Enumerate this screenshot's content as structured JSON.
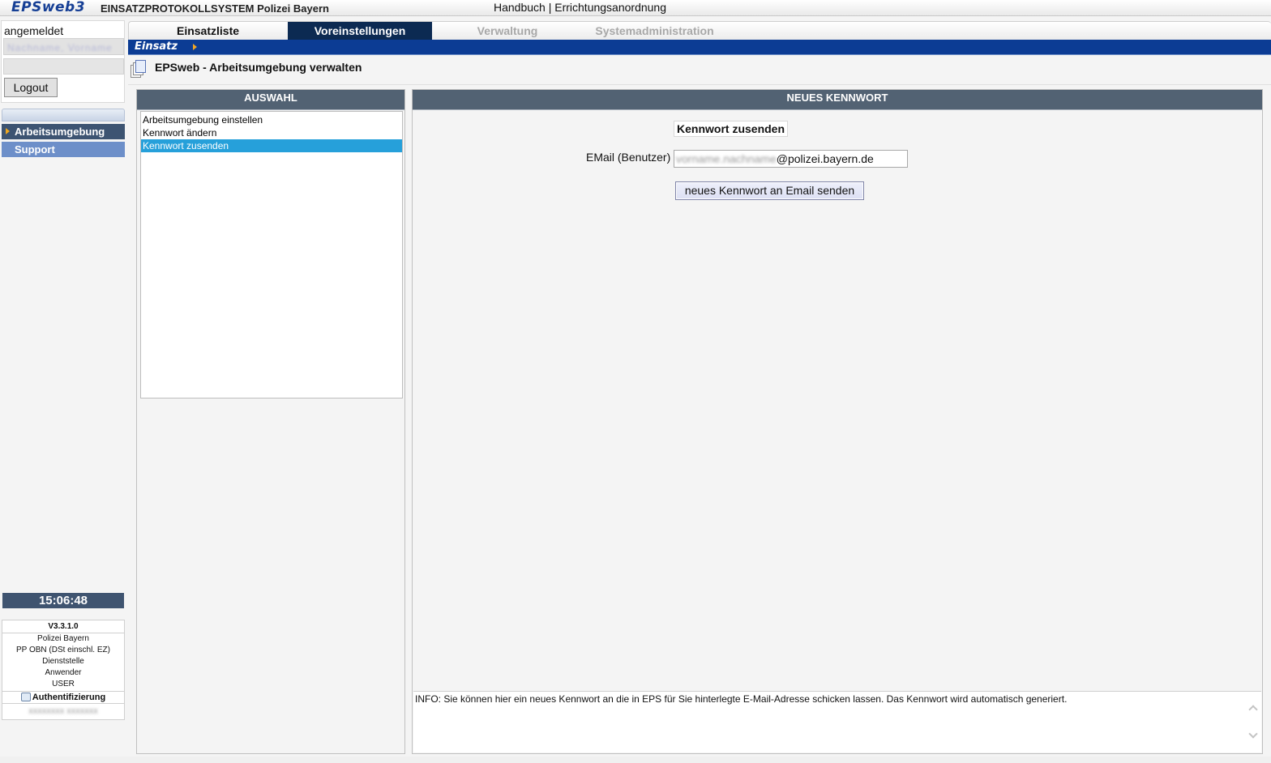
{
  "header": {
    "logo": "EPSweb3",
    "app_name": "EINSATZPROTOKOLLSYSTEM Polizei Bayern",
    "links": [
      "Handbuch",
      "Errichtungsanordnung"
    ],
    "link_separator": "|"
  },
  "sidebar": {
    "logged_in_label": "angemeldet",
    "username_blurred": "Nachname, Vorname",
    "logout_label": "Logout",
    "nav": [
      {
        "label": "Arbeitsumgebung",
        "active": true
      },
      {
        "label": "Support",
        "active": false
      }
    ],
    "clock": "15:06:48",
    "info": {
      "version": "V3.3.1.0",
      "org": "Polizei Bayern",
      "unit": "PP OBN (DSt einschl. EZ)",
      "station": "Dienststelle",
      "role": "Anwender",
      "user": "USER",
      "auth_label": "Authentifizierung",
      "auth_value_blurred": "xxxxxxxx xxxxxxx"
    }
  },
  "tabs": [
    {
      "label": "Einsatzliste",
      "state": "normal"
    },
    {
      "label": "Voreinstellungen",
      "state": "active"
    },
    {
      "label": "Verwaltung",
      "state": "disabled"
    },
    {
      "label": "Systemadministration",
      "state": "disabled"
    }
  ],
  "context_bar": {
    "label": "Einsatz"
  },
  "page": {
    "title": "EPSweb - Arbeitsumgebung verwalten"
  },
  "selection_panel": {
    "header": "AUSWAHL",
    "items": [
      {
        "label": "Arbeitsumgebung einstellen",
        "selected": false
      },
      {
        "label": "Kennwort ändern",
        "selected": false
      },
      {
        "label": "Kennwort zusenden",
        "selected": true
      }
    ]
  },
  "password_panel": {
    "header": "NEUES KENNWORT",
    "form_title": "Kennwort zusenden",
    "email_label": "EMail (Benutzer)",
    "email_value_blurred": "vorname.nachname",
    "email_domain": "@polizei.bayern.de",
    "send_button": "neues Kennwort an Email senden",
    "info_text": "INFO: Sie können hier ein neues Kennwort an die in EPS für Sie hinterlegte E-Mail-Adresse schicken lassen. Das Kennwort wird automatisch generiert."
  },
  "colors": {
    "active_tab": "#0c2a52",
    "context_bar": "#0c3c94",
    "panel_header": "#526273",
    "selection_highlight": "#26a0da",
    "nav_active": "#3d5472",
    "nav_support": "#6d8fc9",
    "breadcrumb_arrow": "#f2a624"
  }
}
